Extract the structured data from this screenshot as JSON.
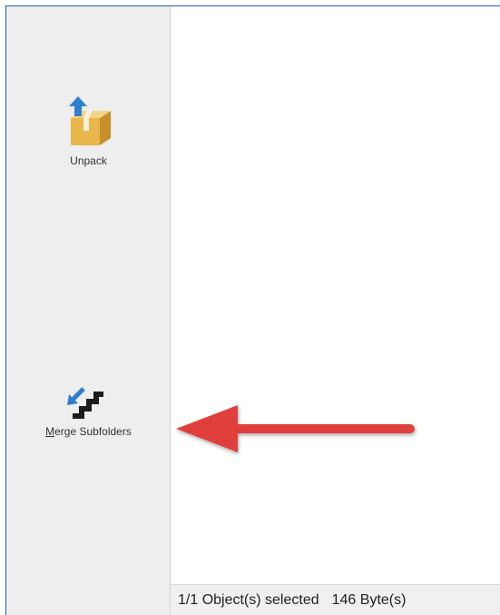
{
  "toolbar": {
    "unpack": {
      "label": "Unpack",
      "icon": "unpack-box-icon"
    },
    "merge": {
      "label_key": "M",
      "label_rest": "erge Subfolders",
      "icon": "merge-subfolders-icon"
    }
  },
  "status": {
    "selection": "1/1 Object(s) selected",
    "size": "146 Byte(s)"
  },
  "annotation": {
    "arrow_color": "#e0413a"
  },
  "colors": {
    "frame_border": "#1f5fa8",
    "toolbar_bg": "#eeeeee",
    "box_color": "#e8b84a",
    "arrow_blue": "#2f7fd0"
  }
}
